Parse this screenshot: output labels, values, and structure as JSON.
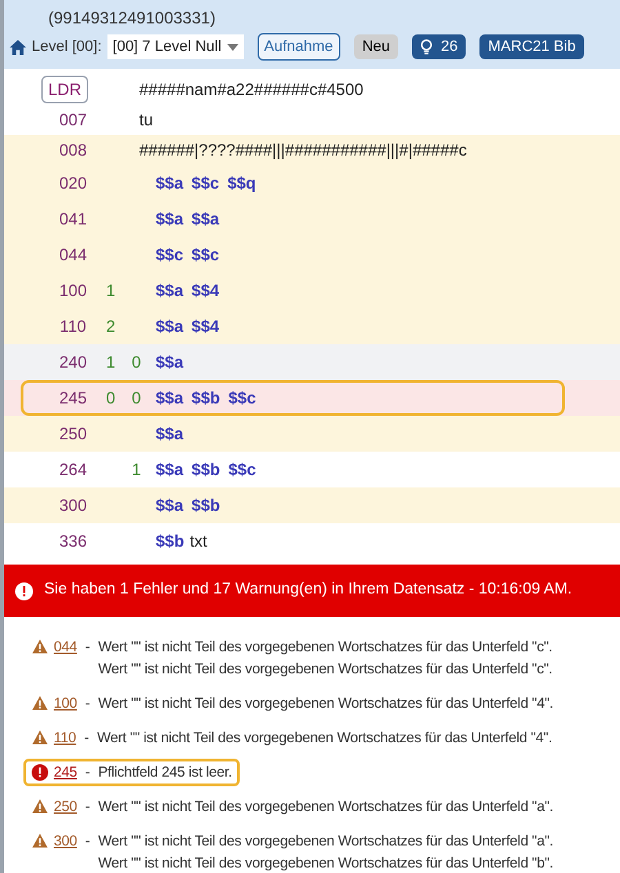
{
  "record_id": "(99149312491003331)",
  "toolbar": {
    "level_label": "Level [00]:",
    "level_select": "[00] 7 Level Null",
    "buttons": [
      {
        "label": "Aufnahme",
        "kind": "outline"
      },
      {
        "label": "Neu",
        "kind": "plain"
      },
      {
        "label": "26",
        "kind": "badge"
      },
      {
        "label": "MARC21 Bib",
        "kind": "solid"
      }
    ]
  },
  "fields": [
    {
      "tag": "LDR",
      "kind": "leader",
      "text": "#####nam#a22######c#4500",
      "color": "#ffffff",
      "selected": false
    },
    {
      "tag": "007",
      "kind": "fixed",
      "text": "tu",
      "color": "#ffffff",
      "selected": false
    },
    {
      "tag": "008",
      "kind": "fixed",
      "text": "######|????####|||###########|||#|#####c",
      "color": "#fdf5dc",
      "selected": false
    },
    {
      "tag": "020",
      "kind": "data",
      "subfields": [
        {
          "code": "$$a"
        },
        {
          "code": "$$c"
        },
        {
          "code": "$$q"
        }
      ],
      "color": "#fdf5dc",
      "selected": false
    },
    {
      "tag": "041",
      "kind": "data",
      "subfields": [
        {
          "code": "$$a"
        },
        {
          "code": "$$a"
        }
      ],
      "color": "#fdf5dc",
      "selected": false
    },
    {
      "tag": "044",
      "kind": "data",
      "subfields": [
        {
          "code": "$$c"
        },
        {
          "code": "$$c"
        }
      ],
      "color": "#fdf5dc",
      "selected": false
    },
    {
      "tag": "100",
      "kind": "data",
      "ind1": "1",
      "subfields": [
        {
          "code": "$$a"
        },
        {
          "code": "$$4"
        }
      ],
      "color": "#fdf5dc",
      "selected": false
    },
    {
      "tag": "110",
      "kind": "data",
      "ind1": "2",
      "subfields": [
        {
          "code": "$$a"
        },
        {
          "code": "$$4"
        }
      ],
      "color": "#fdf5dc",
      "selected": false
    },
    {
      "tag": "240",
      "kind": "data",
      "ind1": "1",
      "ind2": "0",
      "subfields": [
        {
          "code": "$$a"
        }
      ],
      "color": "#f1f2f4",
      "selected": false
    },
    {
      "tag": "245",
      "kind": "data",
      "ind1": "0",
      "ind2": "0",
      "subfields": [
        {
          "code": "$$a"
        },
        {
          "code": "$$b"
        },
        {
          "code": "$$c"
        }
      ],
      "color": "#fbe6e6",
      "selected": true
    },
    {
      "tag": "250",
      "kind": "data",
      "subfields": [
        {
          "code": "$$a"
        }
      ],
      "color": "#fdf5dc",
      "selected": false
    },
    {
      "tag": "264",
      "kind": "data",
      "ind2": "1",
      "subfields": [
        {
          "code": "$$a"
        },
        {
          "code": "$$b"
        },
        {
          "code": "$$c"
        }
      ],
      "color": "#ffffff",
      "selected": false
    },
    {
      "tag": "300",
      "kind": "data",
      "subfields": [
        {
          "code": "$$a"
        },
        {
          "code": "$$b"
        }
      ],
      "color": "#fdf5dc",
      "selected": false
    },
    {
      "tag": "336",
      "kind": "data",
      "subfields": [
        {
          "code": "$$b",
          "value": "txt"
        }
      ],
      "color": "#ffffff",
      "selected": false
    }
  ],
  "banner": "Sie haben 1 Fehler und 17 Warnung(en) in Ihrem Datensatz - 10:16:09 AM.",
  "messages": [
    {
      "kind": "warning",
      "tag": "044",
      "separator": "-",
      "lines": [
        "Wert \"\" ist nicht Teil des vorgegebenen Wortschatzes für das Unterfeld \"c\".",
        "Wert \"\" ist nicht Teil des vorgegebenen Wortschatzes für das Unterfeld \"c\"."
      ],
      "selected": false
    },
    {
      "kind": "warning",
      "tag": "100",
      "separator": "-",
      "lines": [
        "Wert \"\" ist nicht Teil des vorgegebenen Wortschatzes für das Unterfeld \"4\"."
      ],
      "selected": false
    },
    {
      "kind": "warning",
      "tag": "110",
      "separator": "-",
      "lines": [
        "Wert \"\" ist nicht Teil des vorgegebenen Wortschatzes für das Unterfeld \"4\"."
      ],
      "selected": false
    },
    {
      "kind": "error",
      "tag": "245",
      "separator": "-",
      "lines": [
        "Pflichtfeld 245 ist leer."
      ],
      "selected": true
    },
    {
      "kind": "warning",
      "tag": "250",
      "separator": "-",
      "lines": [
        "Wert \"\" ist nicht Teil des vorgegebenen Wortschatzes für das Unterfeld \"a\"."
      ],
      "selected": false
    },
    {
      "kind": "warning",
      "tag": "300",
      "separator": "-",
      "lines": [
        "Wert \"\" ist nicht Teil des vorgegebenen Wortschatzes für das Unterfeld \"a\".",
        "Wert \"\" ist nicht Teil des vorgegebenen Wortschatzes für das Unterfeld \"b\"."
      ],
      "selected": false
    }
  ]
}
